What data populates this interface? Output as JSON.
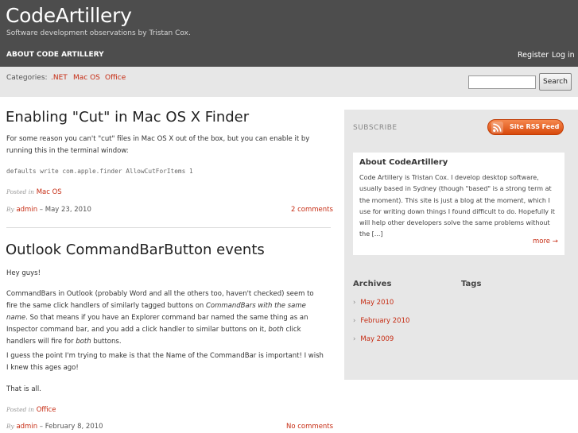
{
  "header": {
    "site_title": "CodeArtillery",
    "tagline": "Software development observations by Tristan Cox.",
    "nav_about": "ABOUT CODE ARTILLERY",
    "register": "Register",
    "login": "Log in"
  },
  "categories_bar": {
    "label": "Categories:",
    "items": [
      ".NET",
      "Mac OS",
      "Office"
    ],
    "search_button": "Search",
    "search_value": ""
  },
  "posts": [
    {
      "title": "Enabling \"Cut\" in Mac OS X Finder",
      "paragraphs": [
        "For some reason you can't \"cut\" files in Mac OS X out of the box, but you can enable it by running this in the terminal window:"
      ],
      "code": "defaults write com.apple.finder AllowCutForItems 1",
      "posted_in_label": "Posted in",
      "category": "Mac OS",
      "by_label": "By",
      "author": "admin",
      "date": " – May 23, 2010",
      "comments": "2 comments"
    },
    {
      "title": "Outlook CommandBarButton events",
      "paragraphs": [
        "Hey guys!",
        "CommandBars in Outlook (probably Word and all the others too, haven't checked) seem to fire the same click handlers of similarly tagged buttons on",
        "CommandBars with the same name",
        ". So that means if you have an Explorer command bar named the same thing as an Inspector command bar, and you add a click handler to similar buttons on it,",
        "both",
        " click handlers will fire for",
        "both",
        " buttons.",
        "I guess the point I'm trying to make is that the Name of the CommandBar is important! I wish I knew this ages ago!",
        "That is all."
      ],
      "posted_in_label": "Posted in",
      "category": "Office",
      "by_label": "By",
      "author": "admin",
      "date": " – February 8, 2010",
      "comments": "No comments"
    }
  ],
  "sidebar": {
    "subscribe_label": "SUBSCRIBE",
    "rss_label": "Site RSS Feed",
    "about_title": "About CodeArtillery",
    "about_text": "Code Artillery is Tristan Cox. I develop desktop software, usually based in Sydney (though \"based\" is a strong term at the moment). This site is just a blog at the moment, which I use for writing down things I found difficult to do. Hopefully it will help other developers solve the same problems without the [...]",
    "about_more": "more →",
    "archives_title": "Archives",
    "tags_title": "Tags",
    "archives": [
      "May 2010",
      "February 2010",
      "May 2009"
    ],
    "archive_bullet": "›"
  },
  "colors": {
    "header_bg": "#4d4d4d",
    "link": "#c62b12",
    "bar_bg": "#e7e7e7",
    "rss_orange": "#e8601e"
  }
}
